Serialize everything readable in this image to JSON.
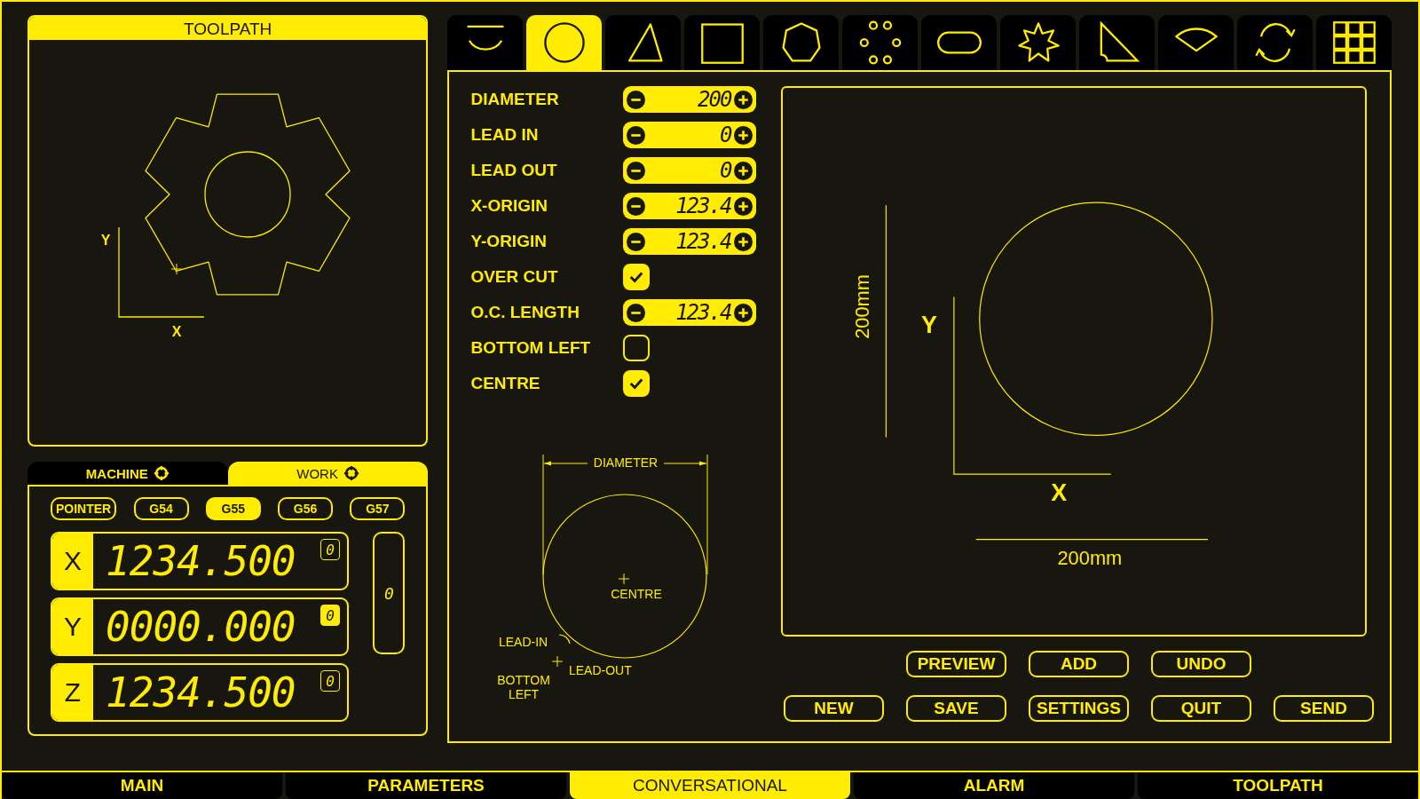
{
  "toolpath_panel": {
    "title": "TOOLPATH",
    "y_label": "Y",
    "x_label": "X"
  },
  "coordinate_tabs": [
    {
      "label": "MACHINE",
      "selected": false
    },
    {
      "label": "WORK",
      "selected": true
    }
  ],
  "offsets": [
    {
      "label": "POINTER",
      "selected": false
    },
    {
      "label": "G54",
      "selected": false
    },
    {
      "label": "G55",
      "selected": true
    },
    {
      "label": "G56",
      "selected": false
    },
    {
      "label": "G57",
      "selected": false
    }
  ],
  "axes": [
    {
      "label": "X",
      "value": "1234.500",
      "indicator": "0",
      "highlighted": false
    },
    {
      "label": "Y",
      "value": "0000.000",
      "indicator": "0",
      "highlighted": true
    },
    {
      "label": "Z",
      "value": "1234.500",
      "indicator": "0",
      "highlighted": false
    }
  ],
  "side_indicator": "0",
  "shape_tabs": [
    {
      "kind": "arc",
      "selected": false
    },
    {
      "kind": "circle",
      "selected": true
    },
    {
      "kind": "triangle",
      "selected": false
    },
    {
      "kind": "rectangle",
      "selected": false
    },
    {
      "kind": "polygon",
      "selected": false
    },
    {
      "kind": "bolt-circle",
      "selected": false
    },
    {
      "kind": "slot",
      "selected": false
    },
    {
      "kind": "star",
      "selected": false
    },
    {
      "kind": "corner",
      "selected": false
    },
    {
      "kind": "sector",
      "selected": false
    },
    {
      "kind": "rotate",
      "selected": false
    },
    {
      "kind": "grid",
      "selected": false
    }
  ],
  "parameters": [
    {
      "label": "DIAMETER",
      "kind": "stepper",
      "value": "200"
    },
    {
      "label": "LEAD IN",
      "kind": "stepper",
      "value": "0"
    },
    {
      "label": "LEAD OUT",
      "kind": "stepper",
      "value": "0"
    },
    {
      "label": "X-ORIGIN",
      "kind": "stepper",
      "value": "123.4"
    },
    {
      "label": "Y-ORIGIN",
      "kind": "stepper",
      "value": "123.4"
    },
    {
      "label": "OVER CUT",
      "kind": "checkbox",
      "checked": true
    },
    {
      "label": "O.C. LENGTH",
      "kind": "stepper",
      "value": "123.4"
    },
    {
      "label": "BOTTOM LEFT",
      "kind": "checkbox",
      "checked": false
    },
    {
      "label": "CENTRE",
      "kind": "checkbox",
      "checked": true
    }
  ],
  "diagram": {
    "diameter": "DIAMETER",
    "centre": "CENTRE",
    "lead_in": "LEAD-IN",
    "lead_out": "LEAD-OUT",
    "bottom_left": "BOTTOM LEFT"
  },
  "preview": {
    "y_label": "Y",
    "x_label": "X",
    "height_dimension": "200mm",
    "width_dimension": "200mm"
  },
  "button_rows": [
    [
      "PREVIEW",
      "ADD",
      "UNDO"
    ],
    [
      "NEW",
      "SAVE",
      "SETTINGS",
      "QUIT",
      "SEND"
    ]
  ],
  "nav": [
    {
      "label": "MAIN",
      "selected": false
    },
    {
      "label": "PARAMETERS",
      "selected": false
    },
    {
      "label": "CONVERSATIONAL",
      "selected": true
    },
    {
      "label": "ALARM",
      "selected": false
    },
    {
      "label": "TOOLPATH",
      "selected": false
    }
  ]
}
